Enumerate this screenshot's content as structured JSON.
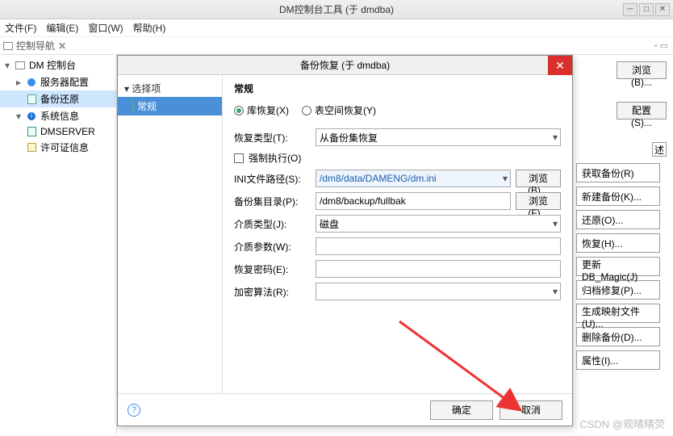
{
  "window": {
    "title": "DM控制台工具 (于 dmdba)",
    "menus": [
      "文件(F)",
      "编辑(E)",
      "窗口(W)",
      "帮助(H)"
    ],
    "nav_tab": "控制导航"
  },
  "tree": {
    "root": "DM 控制台",
    "items": [
      {
        "label": "服务器配置",
        "type": "config"
      },
      {
        "label": "备份还原",
        "type": "doc",
        "selected": true
      },
      {
        "label": "系统信息",
        "type": "info"
      },
      {
        "label": "DMSERVER",
        "type": "server"
      },
      {
        "label": "许可证信息",
        "type": "license"
      }
    ]
  },
  "dialog": {
    "title": "备份恢复 (于 dmdba)",
    "nav_header": "选择项",
    "nav_item": "常规",
    "section": "常规",
    "radio1": "库恢复(X)",
    "radio2": "表空间恢复(Y)",
    "recovery_type_label": "恢复类型(T):",
    "recovery_type_value": "从备份集恢复",
    "force_exec": "强制执行(O)",
    "ini_label": "INI文件路径(S):",
    "ini_value": "/dm8/data/DAMENG/dm.ini",
    "browse_b": "浏览(B)...",
    "bakdir_label": "备份集目录(P):",
    "bakdir_value": "/dm8/backup/fullbak",
    "browse_f": "浏览(F)...",
    "media_label": "介质类型(J):",
    "media_value": "磁盘",
    "param_label": "介质参数(W):",
    "pwd_label": "恢复密码(E):",
    "algo_label": "加密算法(R):",
    "ok": "确定",
    "cancel": "取消"
  },
  "right": {
    "browse": "浏览(B)...",
    "config": "配置(S)...",
    "shu": "述",
    "buttons": [
      "获取备份(R)",
      "新建备份(K)...",
      "还原(O)...",
      "恢复(H)...",
      "更新DB_Magic(J)",
      "归档修复(P)...",
      "生成映射文件(U)...",
      "删除备份(D)...",
      "属性(I)..."
    ]
  },
  "watermark": "CSDN @观晴晴荧"
}
